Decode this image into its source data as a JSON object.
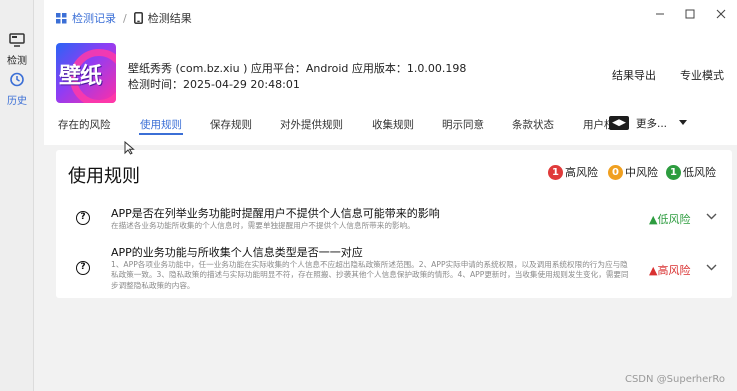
{
  "sidebar": {
    "items": [
      {
        "label": "检测",
        "icon": "detect-icon"
      },
      {
        "label": "历史",
        "icon": "history-icon"
      }
    ]
  },
  "breadcrumb": {
    "link": "检测记录",
    "separator": "/",
    "current": "检测结果"
  },
  "app": {
    "logo_text": "壁纸",
    "line1": "壁纸秀秀 (com.bz.xiu ) 应用平台：Android 应用版本：1.0.00.198",
    "line2": "检测时间：2025-04-29 20:48:01"
  },
  "header_actions": {
    "export": "结果导出",
    "expert": "专业模式"
  },
  "tabs": [
    {
      "label": "存在的风险",
      "active": false
    },
    {
      "label": "使用规则",
      "active": true
    },
    {
      "label": "保存规则",
      "active": false
    },
    {
      "label": "对外提供规则",
      "active": false
    },
    {
      "label": "收集规则",
      "active": false
    },
    {
      "label": "明示同意",
      "active": false
    },
    {
      "label": "条款状态",
      "active": false
    },
    {
      "label": "用户权限",
      "active": false
    }
  ],
  "more": {
    "label": "更多..."
  },
  "section": {
    "title": "使用规则",
    "legend": [
      {
        "count": "1",
        "label": "高风险",
        "color": "#e03a3a"
      },
      {
        "count": "0",
        "label": "中风险",
        "color": "#f0a020"
      },
      {
        "count": "1",
        "label": "低风险",
        "color": "#2d9c3f"
      }
    ]
  },
  "rules": [
    {
      "title": "APP是否在列举业务功能时提醒用户不提供个人信息可能带来的影响",
      "description": "在描述各业务功能所收集的个人信息时，需要单独提醒用户不提供个人信息所带来的影响。",
      "risk": "▲低风险",
      "level": "low"
    },
    {
      "title": "APP的业务功能与所收集个人信息类型是否一一对应",
      "description": "1、APP各项业务功能中，任一业务功能在实际收集的个人信息不应超出隐私政策所述范围。2、APP实际申请的系统权限，以及调用系统权限的行为应与隐私政策一致。3、隐私政策的描述与实际功能明显不符，存在照搬、抄袭其他个人信息保护政策的情形。4、APP更新时，当收集使用规则发生变化，需要同步调整隐私政策的内容。",
      "risk": "▲高风险",
      "level": "high"
    }
  ],
  "watermark": "CSDN @SuperherRo"
}
